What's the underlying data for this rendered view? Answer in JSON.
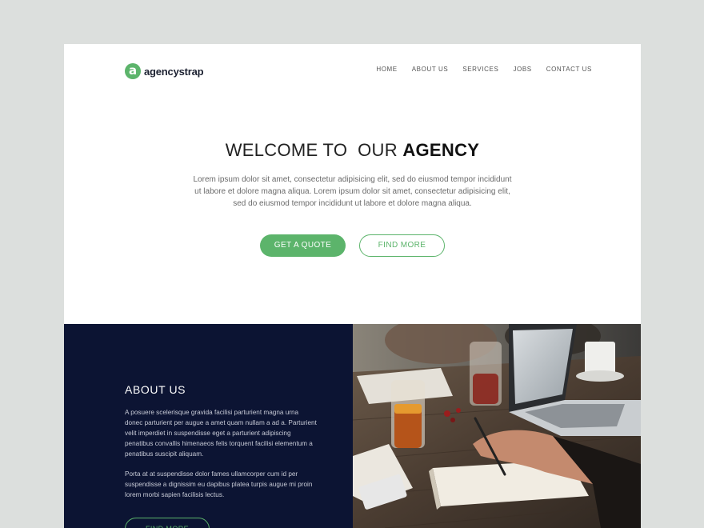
{
  "header": {
    "logo_letter": "a",
    "brand": "agencystrap",
    "nav": [
      "HOME",
      "ABOUT US",
      "SERVICES",
      "JOBS",
      "CONTACT US"
    ]
  },
  "hero": {
    "title_light": "WELCOME TO  OUR ",
    "title_bold": "AGENCY",
    "text": "Lorem ipsum dolor sit amet, consectetur adipisicing elit, sed do eiusmod tempor incididunt ut labore et dolore magna aliqua. Lorem ipsum dolor sit amet, consectetur adipisicing elit, sed do eiusmod tempor incididunt ut labore et dolore magna aliqua.",
    "primary_button": "GET A QUOTE",
    "secondary_button": "FIND MORE"
  },
  "about": {
    "title": "ABOUT US",
    "paragraph1": "A posuere scelerisque gravida facilisi parturient magna urna donec parturient per augue a amet quam nullam a ad a. Parturient velit imperdiet in suspendisse eget a parturient adipiscing penatibus convallis himenaeos felis torquent facilisi elementum a penatibus suscipit aliquam.",
    "paragraph2": "Porta at at suspendisse dolor fames ullamcorper cum id per suspendisse a dignissim eu dapibus platea turpis augue mi proin lorem morbi sapien facilisis lectus.",
    "button": "FIND MORE"
  },
  "colors": {
    "accent": "#5cb46b",
    "navy": "#0c1433",
    "backdrop": "#dcdfdd"
  }
}
